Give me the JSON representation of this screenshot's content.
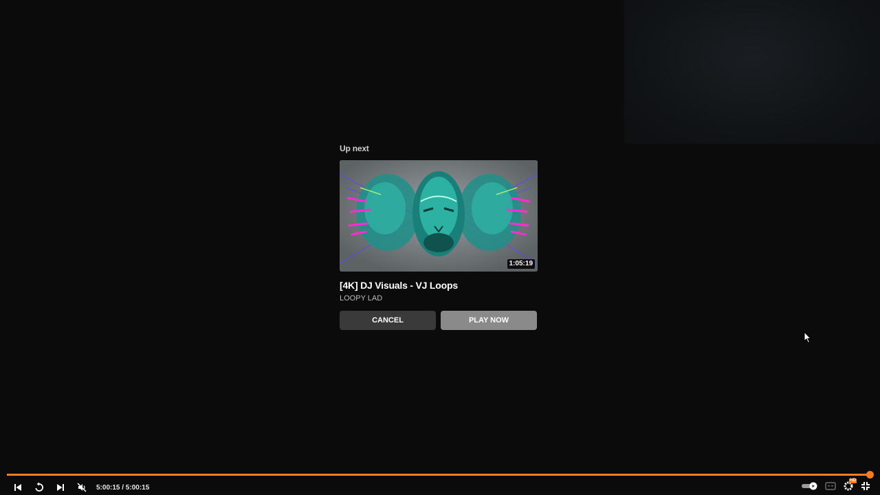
{
  "upnext": {
    "label": "Up next",
    "video": {
      "title": "[4K] DJ Visuals - VJ Loops",
      "channel": "LOOPY LAD",
      "duration": "1:05:19"
    },
    "cancel_label": "CANCEL",
    "play_now_label": "PLAY NOW"
  },
  "controls": {
    "time": "5:00:15 / 5:00:15",
    "progress_fraction": 1.0,
    "accent_color": "#f57c1f",
    "left_icons": [
      "previous-icon",
      "replay-icon",
      "next-icon",
      "mute-icon"
    ],
    "right_icons": [
      "autoplay-toggle-icon",
      "subtitles-icon",
      "settings-icon",
      "exit-fullscreen-icon"
    ],
    "settings_badge": "HD"
  }
}
